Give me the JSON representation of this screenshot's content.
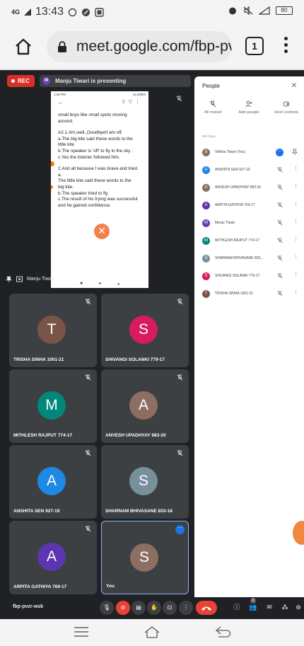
{
  "status_bar": {
    "network": "4G",
    "time": "13:43",
    "battery": "80"
  },
  "browser": {
    "url": "meet.google.com/fbp-pv",
    "tab_count": "1"
  },
  "meeting": {
    "rec_label": "REC",
    "presenter_initial": "M",
    "presenting_text": "Manju Tiwari is presenting",
    "presenter_name": "Manju Tiwari",
    "meeting_code": "fbp-pvzr-wsk",
    "participant_badge": "9"
  },
  "shared_screen": {
    "status_time": "1:46 PM",
    "status_right": "14.4KB/s",
    "lines": [
      "small boys like small spots moving",
      "around.",
      "",
      "A2.1.Ah!,well.,Goodbye!I am off.",
      "a.The big kite said these words to the",
      "little kite",
      "b.The speaker is 'off' to fly in the sky .",
      "c.Yes the listener followed him.",
      "",
      "2.And all because I was brave and tried.",
      "a.",
      "The little kite said these words to the",
      "big kite.",
      "b.The speaker tried to fly.",
      "c.The result of his trying was successful",
      "and he gained confidence."
    ]
  },
  "tiles": [
    {
      "name": "TRISHA SINHA 1001-21",
      "initial": "T",
      "color": "#795548"
    },
    {
      "name": "SHIVANGI SOLANKI 779-17",
      "initial": "S",
      "color": "#d81b60"
    },
    {
      "name": "MITHLESH RAJPUT 774-17",
      "initial": "M",
      "color": "#00897b"
    },
    {
      "name": "ANVESH UPADHYAY 983-20",
      "initial": "A",
      "color": "#8d6e63"
    },
    {
      "name": "ANSHITA SEN 927-19",
      "initial": "A",
      "color": "#1e88e5"
    },
    {
      "name": "SHARNAM BHIVASANE 833-18",
      "initial": "S",
      "color": "#78909c"
    },
    {
      "name": "ARPITA GATHIYA 769-17",
      "initial": "A",
      "color": "#5e35b1"
    },
    {
      "name": "You",
      "initial": "S",
      "color": "#8d6e63"
    }
  ],
  "people_panel": {
    "title": "People",
    "actions": [
      "All muted",
      "Add people",
      "Host controls"
    ],
    "section_label": "IN CALL",
    "participants": [
      {
        "name": "Shikha Tiwari (You)",
        "initial": "S",
        "color": "#8d6e63"
      },
      {
        "name": "ANSHITA SEN 927-19",
        "initial": "A",
        "color": "#1e88e5"
      },
      {
        "name": "ANVESH UPADHYAY 983-20",
        "initial": "A",
        "color": "#8d6e63"
      },
      {
        "name": "ARPITA GATHIYA 769-17",
        "initial": "A",
        "color": "#5e35b1"
      },
      {
        "name": "Manju Tiwari",
        "initial": "M",
        "color": "#6a3fb6"
      },
      {
        "name": "MITHLESH RAJPUT 774-17",
        "initial": "M",
        "color": "#00897b"
      },
      {
        "name": "SHARNAM BHIVASANE 833...",
        "initial": "S",
        "color": "#78909c"
      },
      {
        "name": "SHIVANGI SOLANKI 779-17",
        "initial": "S",
        "color": "#d81b60"
      },
      {
        "name": "TRISHA SINHA 1001-21",
        "initial": "T",
        "color": "#795548"
      }
    ]
  },
  "colors": {
    "meet_background": "#202124",
    "tile_background": "#3c4043",
    "recording_red": "#d93025",
    "accent_blue": "#1a73e8",
    "end_call_red": "#ea4335"
  }
}
